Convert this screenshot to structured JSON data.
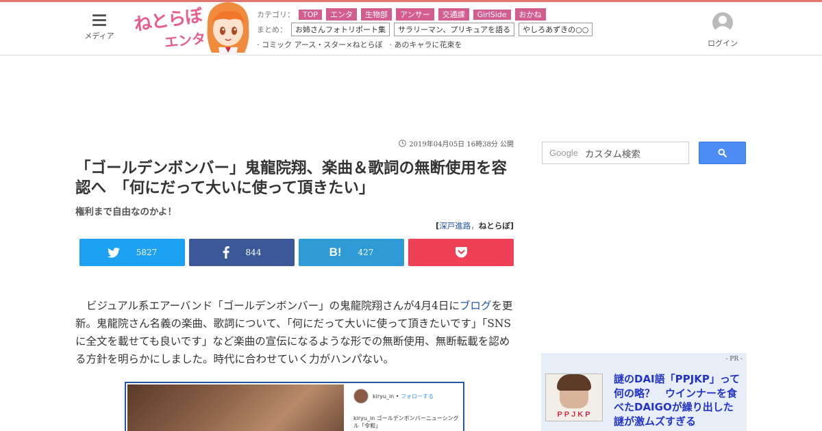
{
  "header": {
    "menu_label": "メディア",
    "logo_main": "ねとらぼ",
    "logo_sub": "エンタ",
    "category_label": "カテゴリ：",
    "categories": [
      "TOP",
      "エンタ",
      "生物部",
      "アンサー",
      "交通課",
      "GirlSide",
      "おかね"
    ],
    "matome_label": "まとめ：",
    "matome": [
      "お姉さんフォトリポート集",
      "サラリーマン、プリキュアを語る",
      "やしろあずきの○○"
    ],
    "extra_links": [
      "· コミック アース・スター×ねとらぼ",
      "· あのキャラに花束を"
    ],
    "login_label": "ログイン"
  },
  "article": {
    "published": "2019年04月05日 16時38分 公開",
    "title": "「ゴールデンボンバー」鬼龍院翔、楽曲＆歌詞の無断使用を容認へ　「何にだって大いに使って頂きたい」",
    "subtitle": "権利まで自由なのかよ！",
    "byline_open": "[",
    "author": "深戸進路",
    "byline_sep": "，",
    "publisher": "ねとらぼ",
    "byline_close": "]",
    "body_before_link": "ビジュアル系エアーバンド「ゴールデンボンバー」の鬼龍院翔さんが4月4日に",
    "body_link": "ブログ",
    "body_after_link": "を更新。鬼龍院さん名義の楽曲、歌詞について、「何にだって大いに使って頂きたいです」「SNSに全文を載せても良いです」など楽曲の宣伝になるような形での無断使用、無断転載を認める方針を明らかにしました。時代に合わせていく力がハンパない。"
  },
  "share": {
    "twitter_count": "5827",
    "facebook_count": "844",
    "hatena_label": "B!",
    "hatena_count": "427"
  },
  "instagram": {
    "user": "kiryu_in",
    "follow": "フォローする",
    "caption": "kiryu_in ゴールデンボンバーニューシングル「令和」"
  },
  "sidebar": {
    "search_brand": "Google",
    "search_placeholder": "カスタム検索",
    "pr_label": "- PR -",
    "pr_title": "謎のDAI語「PPJKP」って何の略？　ウインナーを食べたDAIGOが繰り出した謎が激ムズすぎる",
    "pr_thumb_text": "PPJKP"
  },
  "colors": {
    "accent_line": "#e0776f",
    "category_tag": "#d35d8f",
    "twitter": "#1da1f2",
    "facebook": "#3b5998",
    "hatena": "#2e9bd6",
    "pocket": "#ef4056",
    "link": "#2255aa",
    "pr_background": "#e7eef8"
  }
}
